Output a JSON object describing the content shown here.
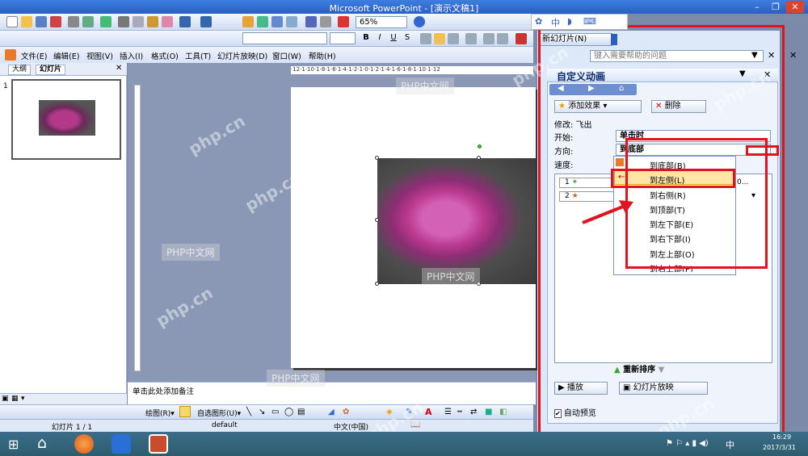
{
  "window": {
    "title": "Microsoft PowerPoint - [演示文稿1]"
  },
  "toolbar": {
    "zoom": "65%"
  },
  "menubar": {
    "items": [
      "文件(E)",
      "编辑(E)",
      "视图(V)",
      "插入(I)",
      "格式(O)",
      "工具(T)",
      "幻灯片放映(D)",
      "窗口(W)",
      "帮助(H)"
    ]
  },
  "outline": {
    "tabs": [
      "大纲",
      "幻灯片"
    ],
    "slide_number": "1"
  },
  "ruler": {
    "labels": "·12·1·10·1·8·1·6·1·4·1·2·1·0·1·2·1·4·1·6·1·8·1·10·1·12"
  },
  "notes": {
    "placeholder": "单击此处添加备注"
  },
  "drawbar": {
    "draw": "绘图(R)▾",
    "autoshapes": "自选图形(U)▾"
  },
  "statusbar": {
    "slide": "幻灯片 1 / 1",
    "design": "default",
    "language": "中文(中国)"
  },
  "taskpane": {
    "new_slide": "新幻灯片(N)",
    "help_placeholder": "键入需要帮助的问题",
    "title": "自定义动画",
    "add_effect": "添加效果",
    "remove": "删除",
    "modify": "修改: 飞出",
    "start_label": "开始:",
    "start_value": "单击时",
    "direction_label": "方向:",
    "direction_value": "到底部",
    "speed_label": "速度:",
    "list_items": [
      "1",
      "2"
    ],
    "list_suffix": "0...",
    "reorder": "重新排序",
    "play": "播放",
    "slideshow": "幻灯片放映",
    "autopreview": "自动预览"
  },
  "direction_menu": [
    "到底部(B)",
    "到左侧(L)",
    "到右侧(R)",
    "到顶部(T)",
    "到左下部(E)",
    "到右下部(I)",
    "到左上部(O)",
    "到右上部(P)"
  ],
  "watermark": {
    "labels": [
      "PHP中文网",
      "PHP中文网",
      "PHP中文网",
      "PHP中文网"
    ],
    "logo_texts": [
      "php.cn"
    ]
  },
  "taskbar": {
    "time": "16:29",
    "date": "2017/3/31",
    "ime": "中"
  }
}
